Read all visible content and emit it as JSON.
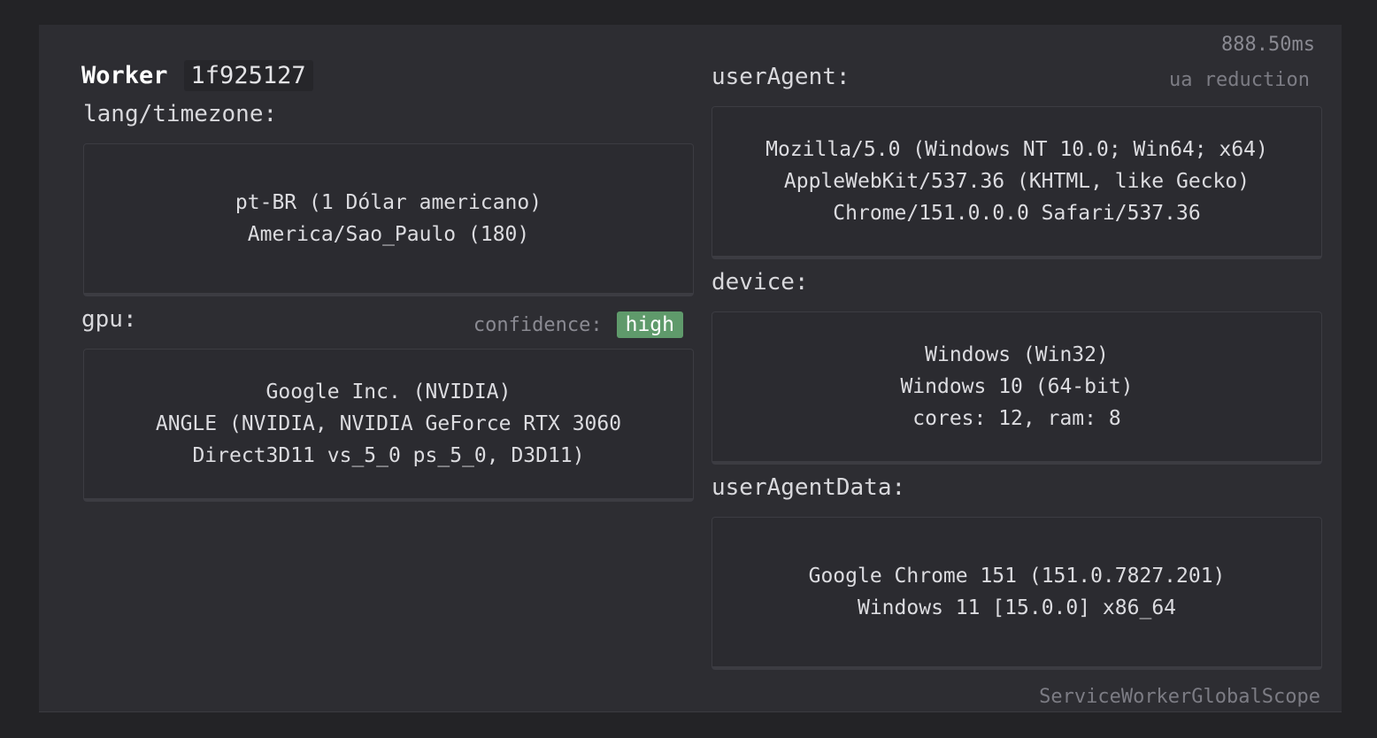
{
  "header": {
    "title": "Worker",
    "hash": "1f925127",
    "timing": "888.50ms",
    "ua_note": "ua reduction"
  },
  "lang_timezone": {
    "label": "lang/timezone:",
    "lines": [
      "pt-BR (1 Dólar americano)",
      "America/Sao_Paulo (180)"
    ]
  },
  "gpu": {
    "label": "gpu:",
    "confidence_label": "confidence:",
    "confidence_value": "high",
    "confidence_color": "#5f9a6b",
    "lines": [
      "Google Inc. (NVIDIA)",
      "ANGLE (NVIDIA, NVIDIA GeForce RTX 3060",
      "Direct3D11 vs_5_0 ps_5_0, D3D11)"
    ]
  },
  "user_agent": {
    "label": "userAgent:",
    "lines": [
      "Mozilla/5.0 (Windows NT 10.0; Win64; x64)",
      "AppleWebKit/537.36 (KHTML, like Gecko)",
      "Chrome/151.0.0.0 Safari/537.36"
    ]
  },
  "device": {
    "label": "device:",
    "lines": [
      "Windows (Win32)",
      "Windows 10 (64-bit)",
      "cores: 12, ram: 8"
    ]
  },
  "user_agent_data": {
    "label": "userAgentData:",
    "lines": [
      "Google Chrome 151 (151.0.7827.201)",
      "Windows 11 [15.0.0] x86_64"
    ]
  },
  "footer": {
    "scope": "ServiceWorkerGlobalScope"
  }
}
